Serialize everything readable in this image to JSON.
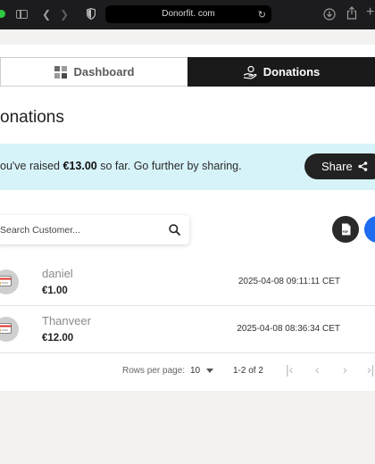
{
  "browser": {
    "url": "Donorfit. com"
  },
  "tabs": {
    "dashboard_label": "Dashboard",
    "donations_label": "Donations"
  },
  "page": {
    "title": "onations"
  },
  "banner": {
    "prefix": "ou've raised ",
    "amount": "€13.00",
    "suffix": " so far. Go further by sharing.",
    "share_label": "Share"
  },
  "search": {
    "placeholder": "Search Customer..."
  },
  "actions": {
    "pdf_label": "PDF"
  },
  "donations": [
    {
      "name": "daniel",
      "amount": "€1.00",
      "date": "2025-04-08 09:11:11 CET"
    },
    {
      "name": "Thanveer",
      "amount": "€12.00",
      "date": "2025-04-08 08:36:34 CET"
    }
  ],
  "pagination": {
    "rows_per_page_label": "Rows per page:",
    "rows_per_page_value": "10",
    "range": "1-2 of 2"
  },
  "colors": {
    "banner_bg": "#d7f3fa",
    "active_tab": "#1a1a1a",
    "blue_action": "#1e6cf0"
  }
}
